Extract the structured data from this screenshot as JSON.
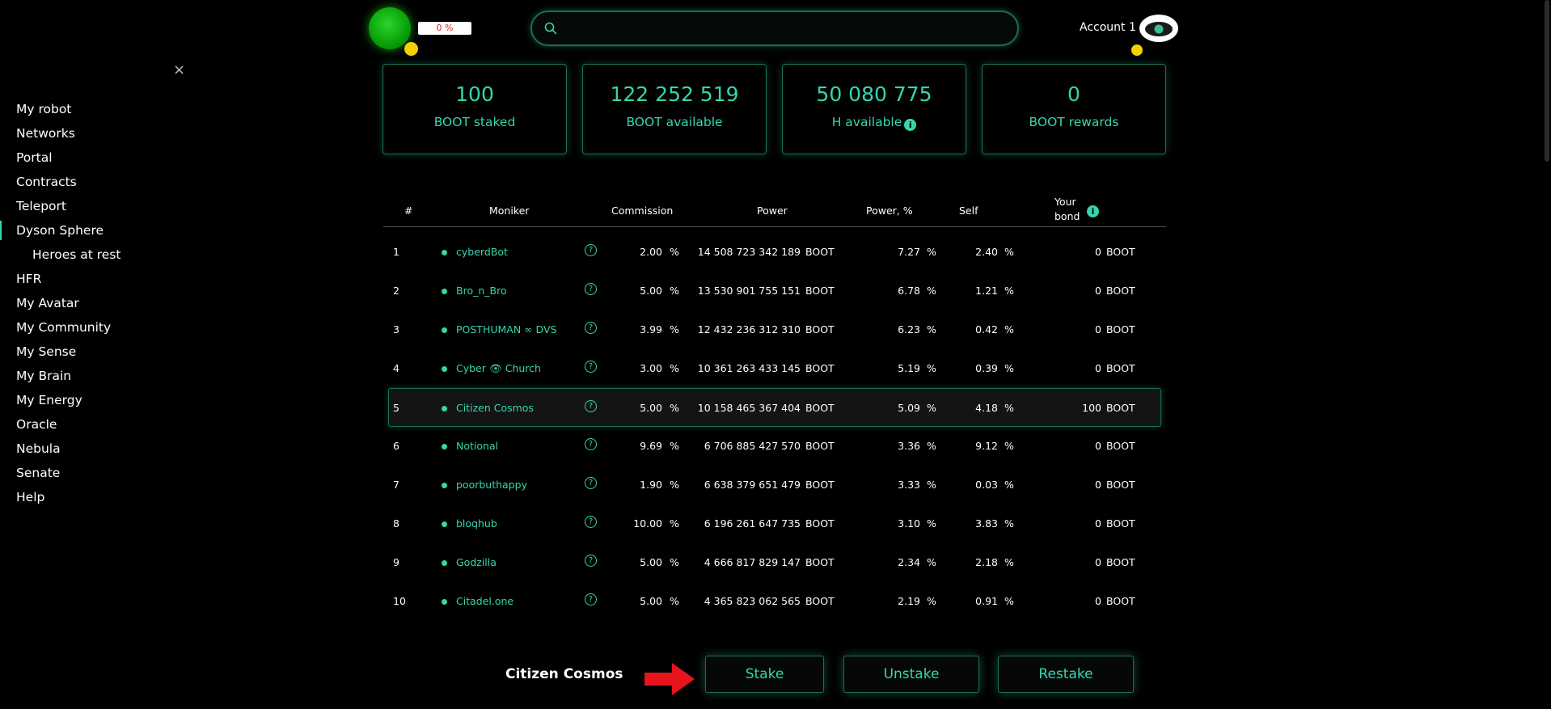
{
  "sidebar": {
    "close_icon": "×",
    "items": [
      {
        "label": "My robot"
      },
      {
        "label": "Networks"
      },
      {
        "label": "Portal"
      },
      {
        "label": "Contracts"
      },
      {
        "label": "Teleport"
      },
      {
        "label": "Dyson Sphere",
        "active": true
      },
      {
        "label": "Heroes at rest",
        "sub": true
      },
      {
        "label": "HFR"
      },
      {
        "label": "My Avatar"
      },
      {
        "label": "My Community"
      },
      {
        "label": "My Sense"
      },
      {
        "label": "My Brain"
      },
      {
        "label": "My Energy"
      },
      {
        "label": "Oracle"
      },
      {
        "label": "Nebula"
      },
      {
        "label": "Senate"
      },
      {
        "label": "Help"
      }
    ]
  },
  "header": {
    "progress": "0 %",
    "search_placeholder": "",
    "account_name": "Account 1",
    "colors": {
      "accent": "#36d6ae",
      "orb": "#1cc41c",
      "dot": "#f5d000"
    }
  },
  "stats": [
    {
      "value": "100",
      "label": "BOOT staked"
    },
    {
      "value": "122 252 519",
      "label": "BOOT available"
    },
    {
      "value": "50 080 775",
      "label": "H available",
      "info": "i"
    },
    {
      "value": "0",
      "label": "BOOT rewards"
    }
  ],
  "table": {
    "headers": {
      "num": "#",
      "moniker": "Moniker",
      "commission": "Commission",
      "power": "Power",
      "power_pct": "Power, %",
      "self": "Self",
      "bond_line1": "Your",
      "bond_line2": "bond",
      "bond_info": "i"
    },
    "rows": [
      {
        "n": "1",
        "moniker": "cyberdBot",
        "commission": "2.00",
        "power": "14 508 723 342 189",
        "power_pct": "7.27",
        "self": "2.40",
        "bond": "0"
      },
      {
        "n": "2",
        "moniker": "Bro_n_Bro",
        "commission": "5.00",
        "power": "13 530 901 755 151",
        "power_pct": "6.78",
        "self": "1.21",
        "bond": "0"
      },
      {
        "n": "3",
        "moniker": "POSTHUMAN ∞ DVS",
        "commission": "3.99",
        "power": "12 432 236 312 310",
        "power_pct": "6.23",
        "self": "0.42",
        "bond": "0"
      },
      {
        "n": "4",
        "moniker": "Cyber 👁 Church",
        "commission": "3.00",
        "power": "10 361 263 433 145",
        "power_pct": "5.19",
        "self": "0.39",
        "bond": "0"
      },
      {
        "n": "5",
        "moniker": "Citizen Cosmos",
        "commission": "5.00",
        "power": "10 158 465 367 404",
        "power_pct": "5.09",
        "self": "4.18",
        "bond": "100",
        "selected": true
      },
      {
        "n": "6",
        "moniker": "Notional",
        "commission": "9.69",
        "power": "6 706 885 427 570",
        "power_pct": "3.36",
        "self": "9.12",
        "bond": "0"
      },
      {
        "n": "7",
        "moniker": "poorbuthappy",
        "commission": "1.90",
        "power": "6 638 379 651 479",
        "power_pct": "3.33",
        "self": "0.03",
        "bond": "0"
      },
      {
        "n": "8",
        "moniker": "bloqhub",
        "commission": "10.00",
        "power": "6 196 261 647 735",
        "power_pct": "3.10",
        "self": "3.83",
        "bond": "0"
      },
      {
        "n": "9",
        "moniker": "Godzilla",
        "commission": "5.00",
        "power": "4 666 817 829 147",
        "power_pct": "2.34",
        "self": "2.18",
        "bond": "0"
      },
      {
        "n": "10",
        "moniker": "Citadel.one",
        "commission": "5.00",
        "power": "4 365 823 062 565",
        "power_pct": "2.19",
        "self": "0.91",
        "bond": "0"
      }
    ],
    "pct_unit": "%",
    "token_unit": "BOOT",
    "question_icon": "?"
  },
  "footer": {
    "selected_validator": "Citizen Cosmos",
    "buttons": {
      "stake": "Stake",
      "unstake": "Unstake",
      "restake": "Restake"
    }
  }
}
